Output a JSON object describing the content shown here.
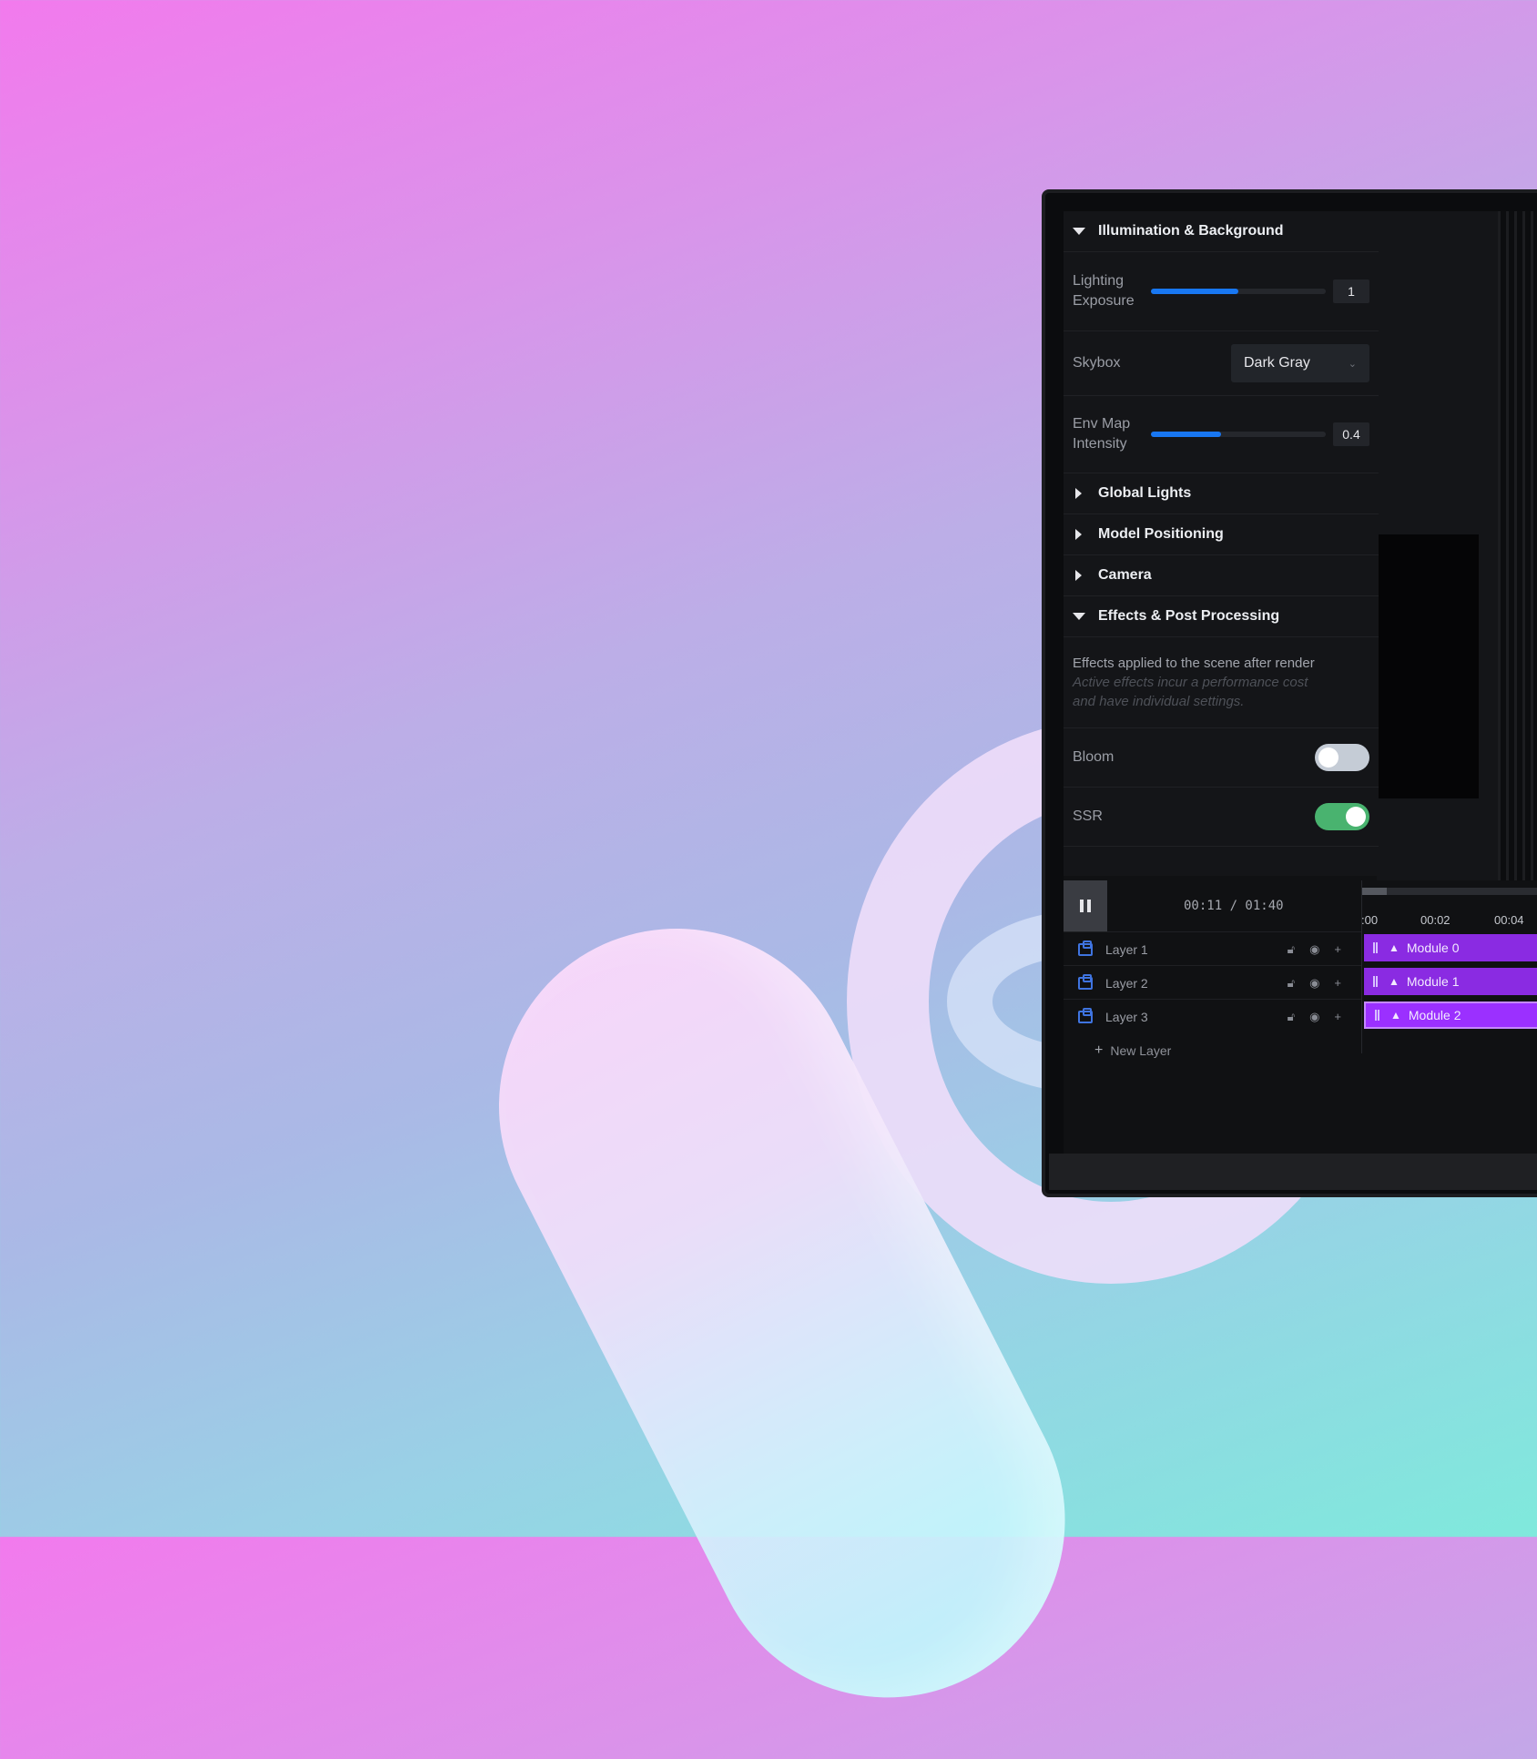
{
  "panel": {
    "illumination": {
      "title": "Illumination & Background",
      "exposure_label": "Lighting Exposure",
      "exposure_value": "1",
      "exposure_fraction": 0.5,
      "skybox_label": "Skybox",
      "skybox_value": "Dark Gray",
      "env_label": "Env Map Intensity",
      "env_value": "0.4",
      "env_fraction": 0.4
    },
    "collapsed_sections": [
      "Global Lights",
      "Model Positioning",
      "Camera"
    ],
    "effects": {
      "title": "Effects & Post Processing",
      "description": "Effects applied to the scene after render",
      "note_line1": "Active effects incur a performance cost",
      "note_line2": "and have individual settings.",
      "bloom_label": "Bloom",
      "bloom_on": false,
      "ssr_label": "SSR",
      "ssr_on": true
    }
  },
  "timeline": {
    "timecode": "00:11 / 01:40",
    "ticks": [
      ":00",
      "00:02",
      "00:04"
    ],
    "layers": [
      {
        "name": "Layer 1",
        "module": "Module 0"
      },
      {
        "name": "Layer 2",
        "module": "Module 1"
      },
      {
        "name": "Layer 3",
        "module": "Module 2"
      }
    ],
    "new_layer_label": "New Layer"
  },
  "colors": {
    "accent_blue": "#1877f2",
    "module_purple": "#8a2be2",
    "toggle_on": "#49b36f",
    "toggle_off": "#c5ccd6"
  }
}
